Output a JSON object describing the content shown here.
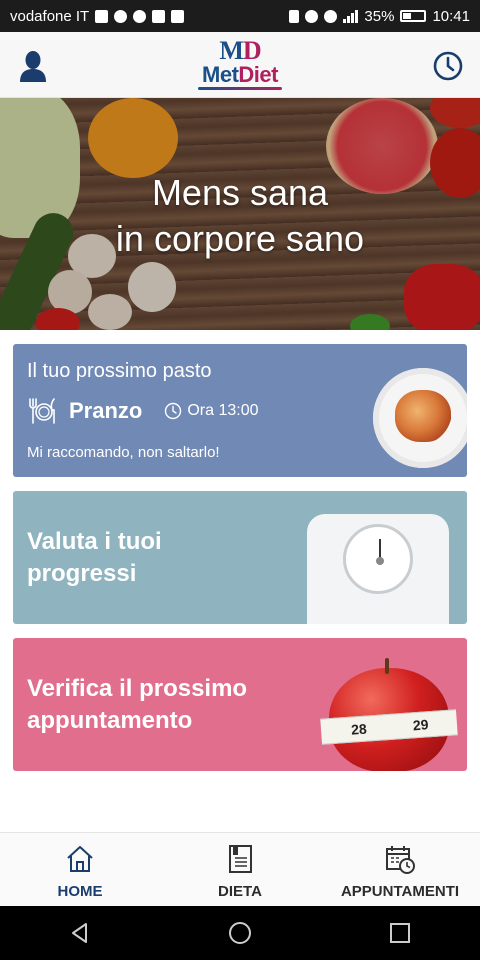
{
  "status_bar": {
    "carrier": "vodafone IT",
    "battery": "35%",
    "time": "10:41"
  },
  "app": {
    "logo_md_m": "M",
    "logo_md_d": "D",
    "logo_met": "Met",
    "logo_diet": "Diet"
  },
  "hero": {
    "line1": "Mens sana",
    "line2": "in corpore sano"
  },
  "meal_card": {
    "title": "Il tuo prossimo pasto",
    "meal_name": "Pranzo",
    "time_label": "Ora 13:00",
    "note": "Mi raccomando, non saltarlo!"
  },
  "progress_card": {
    "line1": "Valuta i tuoi",
    "line2": "progressi"
  },
  "appointment_card": {
    "line1": "Verifica il prossimo",
    "line2": "appuntamento",
    "tape_numbers": [
      "28",
      "29"
    ]
  },
  "bottom_nav": {
    "items": [
      {
        "label": "HOME",
        "icon": "home-icon",
        "active": true
      },
      {
        "label": "DIETA",
        "icon": "book-icon",
        "active": false
      },
      {
        "label": "APPUNTAMENTI",
        "icon": "calendar-clock-icon",
        "active": false
      }
    ]
  },
  "colors": {
    "meal_card": "#7189b5",
    "progress_card": "#8fb3bf",
    "appointment_card": "#e06e8c",
    "brand_blue": "#1b4f8a",
    "brand_magenta": "#b0205e"
  }
}
